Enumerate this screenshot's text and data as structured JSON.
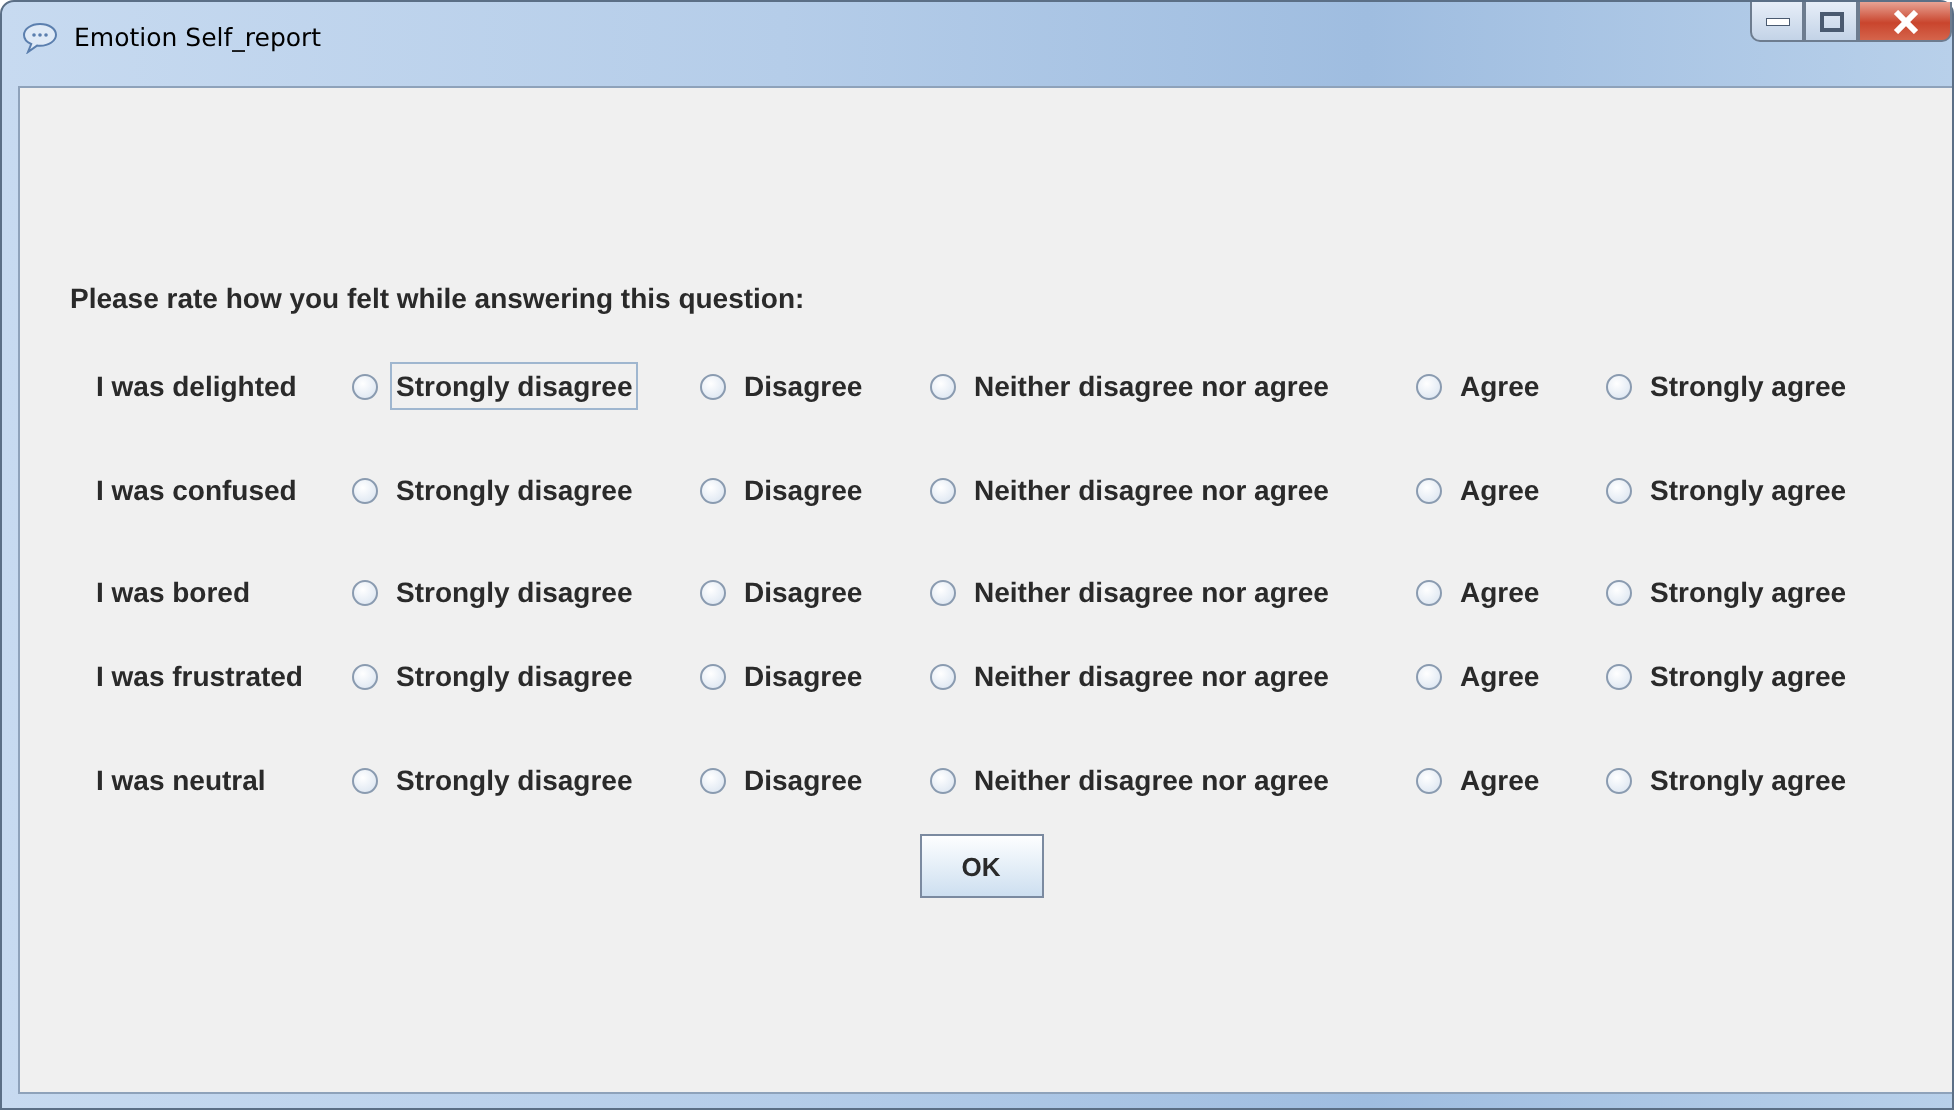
{
  "window": {
    "title": "Emotion Self_report"
  },
  "prompt": "Please rate how you felt while answering this question:",
  "items": [
    {
      "label": "I was delighted",
      "options": [
        {
          "label": "Strongly disagree",
          "selected": false,
          "focused": true
        },
        {
          "label": "Disagree",
          "selected": false,
          "focused": false
        },
        {
          "label": "Neither disagree nor agree",
          "selected": false,
          "focused": false
        },
        {
          "label": "Agree",
          "selected": false,
          "focused": false
        },
        {
          "label": "Strongly agree",
          "selected": false,
          "focused": false
        }
      ]
    },
    {
      "label": "I was confused",
      "options": [
        {
          "label": "Strongly disagree",
          "selected": false,
          "focused": false
        },
        {
          "label": "Disagree",
          "selected": false,
          "focused": false
        },
        {
          "label": "Neither disagree nor agree",
          "selected": false,
          "focused": false
        },
        {
          "label": "Agree",
          "selected": false,
          "focused": false
        },
        {
          "label": "Strongly agree",
          "selected": false,
          "focused": false
        }
      ]
    },
    {
      "label": "I was bored",
      "options": [
        {
          "label": "Strongly disagree",
          "selected": false,
          "focused": false
        },
        {
          "label": "Disagree",
          "selected": false,
          "focused": false
        },
        {
          "label": "Neither disagree nor agree",
          "selected": false,
          "focused": false
        },
        {
          "label": "Agree",
          "selected": false,
          "focused": false
        },
        {
          "label": "Strongly agree",
          "selected": false,
          "focused": false
        }
      ]
    },
    {
      "label": "I was frustrated",
      "options": [
        {
          "label": "Strongly disagree",
          "selected": false,
          "focused": false
        },
        {
          "label": "Disagree",
          "selected": false,
          "focused": false
        },
        {
          "label": "Neither disagree nor agree",
          "selected": false,
          "focused": false
        },
        {
          "label": "Agree",
          "selected": false,
          "focused": false
        },
        {
          "label": "Strongly agree",
          "selected": false,
          "focused": false
        }
      ]
    },
    {
      "label": "I was neutral",
      "options": [
        {
          "label": "Strongly disagree",
          "selected": false,
          "focused": false
        },
        {
          "label": "Disagree",
          "selected": false,
          "focused": false
        },
        {
          "label": "Neither disagree nor agree",
          "selected": false,
          "focused": false
        },
        {
          "label": "Agree",
          "selected": false,
          "focused": false
        },
        {
          "label": "Strongly agree",
          "selected": false,
          "focused": false
        }
      ]
    }
  ],
  "buttons": [
    "OK"
  ]
}
